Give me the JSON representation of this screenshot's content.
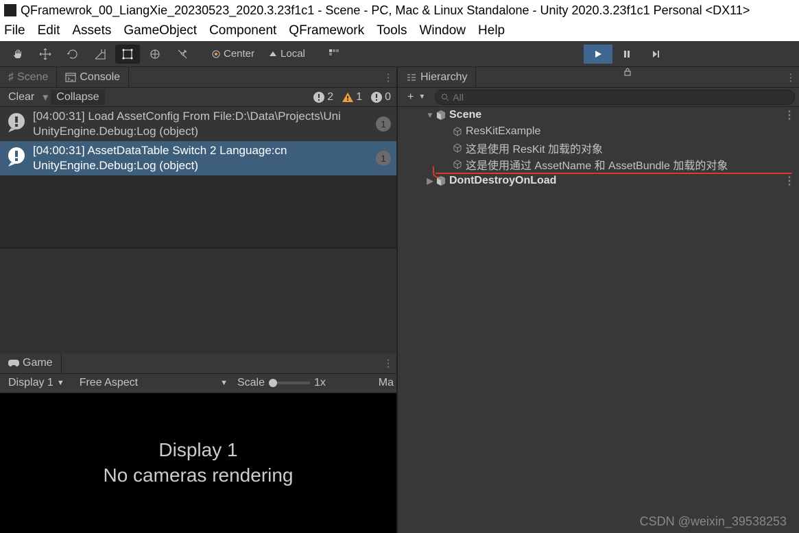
{
  "titlebar": {
    "title": "QFramewrok_00_LiangXie_20230523_2020.3.23f1c1 - Scene - PC, Mac & Linux Standalone - Unity 2020.3.23f1c1 Personal <DX11>"
  },
  "menubar": {
    "items": [
      "File",
      "Edit",
      "Assets",
      "GameObject",
      "Component",
      "QFramework",
      "Tools",
      "Window",
      "Help"
    ]
  },
  "toolbar": {
    "pivot": "Center",
    "handle": "Local"
  },
  "tabs_left": {
    "scene": "Scene",
    "console": "Console"
  },
  "console": {
    "clear": "Clear",
    "collapse": "Collapse",
    "error_count": "2",
    "warn_count": "1",
    "info_count": "0",
    "entries": [
      {
        "line1": "[04:00:31] Load AssetConfig From File:D:\\Data\\Projects\\Uni",
        "line2": "UnityEngine.Debug:Log (object)",
        "count": "1"
      },
      {
        "line1": "[04:00:31] AssetDataTable Switch 2 Language:cn",
        "line2": "UnityEngine.Debug:Log (object)",
        "count": "1"
      }
    ]
  },
  "game": {
    "tab": "Game",
    "display": "Display 1",
    "aspect": "Free Aspect",
    "scale_label": "Scale",
    "scale_value": "1x",
    "maximize": "Ma",
    "msg_line1": "Display 1",
    "msg_line2": "No cameras rendering"
  },
  "hierarchy": {
    "tab": "Hierarchy",
    "search_placeholder": "All",
    "scene": "Scene",
    "items": [
      "ResKitExample",
      "这是使用 ResKit 加载的对象",
      "这是使用通过 AssetName  和 AssetBundle 加载的对象"
    ],
    "dontdestroy": "DontDestroyOnLoad"
  },
  "watermark": "CSDN @weixin_39538253"
}
